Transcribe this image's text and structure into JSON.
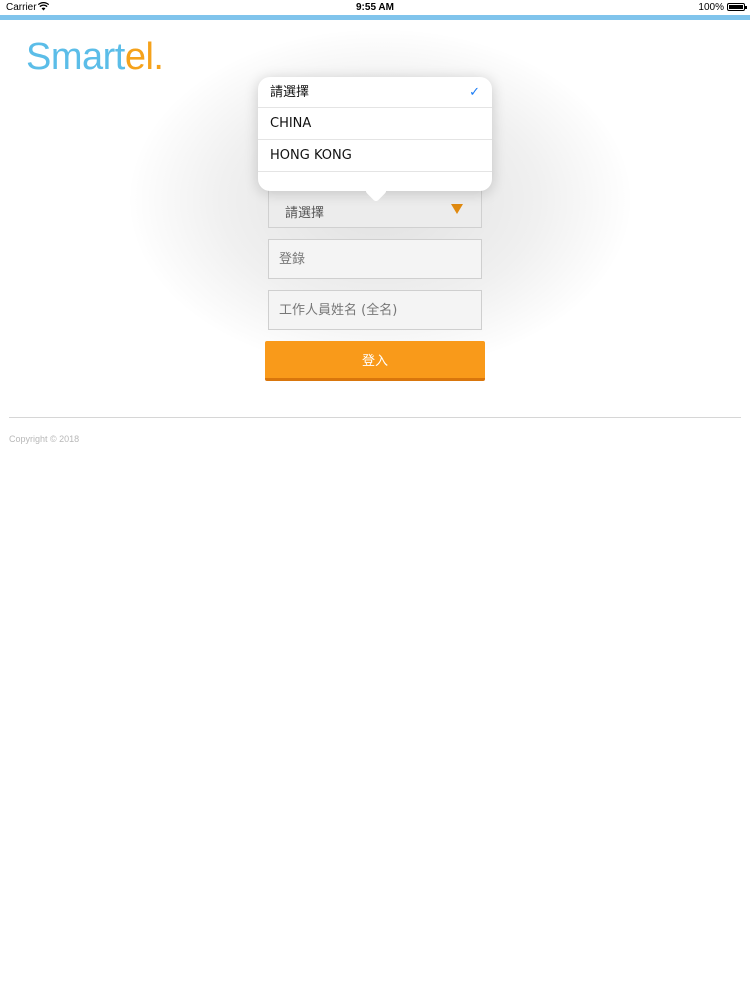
{
  "status_bar": {
    "carrier": "Carrier",
    "time": "9:55 AM",
    "battery": "100%"
  },
  "logo": {
    "part_blue": "Smart",
    "part_orange": "el.",
    "color_blue": "#5bbde8",
    "color_orange": "#f5a21b"
  },
  "form": {
    "region_select": {
      "selected": "請選擇"
    },
    "login_field": {
      "placeholder": "登錄",
      "value": ""
    },
    "staff_name_field": {
      "placeholder": "工作人員姓名 (全名)",
      "value": ""
    },
    "submit_label": "登入",
    "accent_color": "#f99a1a"
  },
  "dropdown": {
    "options": [
      {
        "label": "請選擇",
        "selected": true
      },
      {
        "label": "CHINA",
        "selected": false
      },
      {
        "label": "HONG KONG",
        "selected": false
      }
    ],
    "check_icon": "checkmark-icon",
    "check_color": "#1a7cf5"
  },
  "footer": {
    "copyright": "Copyright © 2018"
  }
}
